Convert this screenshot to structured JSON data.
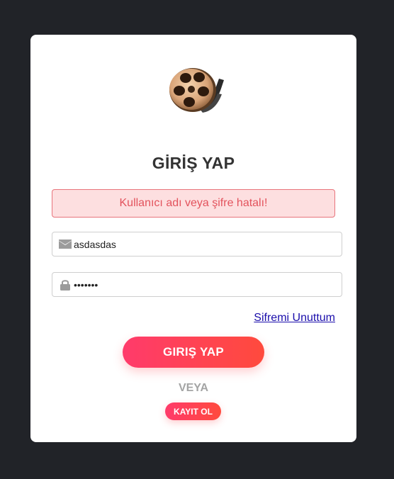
{
  "logo": {
    "icon": "film-reel-icon"
  },
  "title": "GİRİŞ YAP",
  "alert": {
    "message": "Kullanıcı adı veya şifre hatalı!"
  },
  "username": {
    "value": "asdasdas",
    "icon": "envelope-icon"
  },
  "password": {
    "value": "asdasda",
    "icon": "lock-icon"
  },
  "forgot_link": "Sifremi Unuttum",
  "login_button": "GIRIŞ YAP",
  "or_text": "VEYA",
  "register_button": "KAYIT OL",
  "colors": {
    "background": "#212328",
    "card": "#ffffff",
    "accent_start": "#ff3b6b",
    "accent_end": "#ff4a3d",
    "alert_bg": "#fddfe0",
    "alert_text": "#e3535d"
  }
}
